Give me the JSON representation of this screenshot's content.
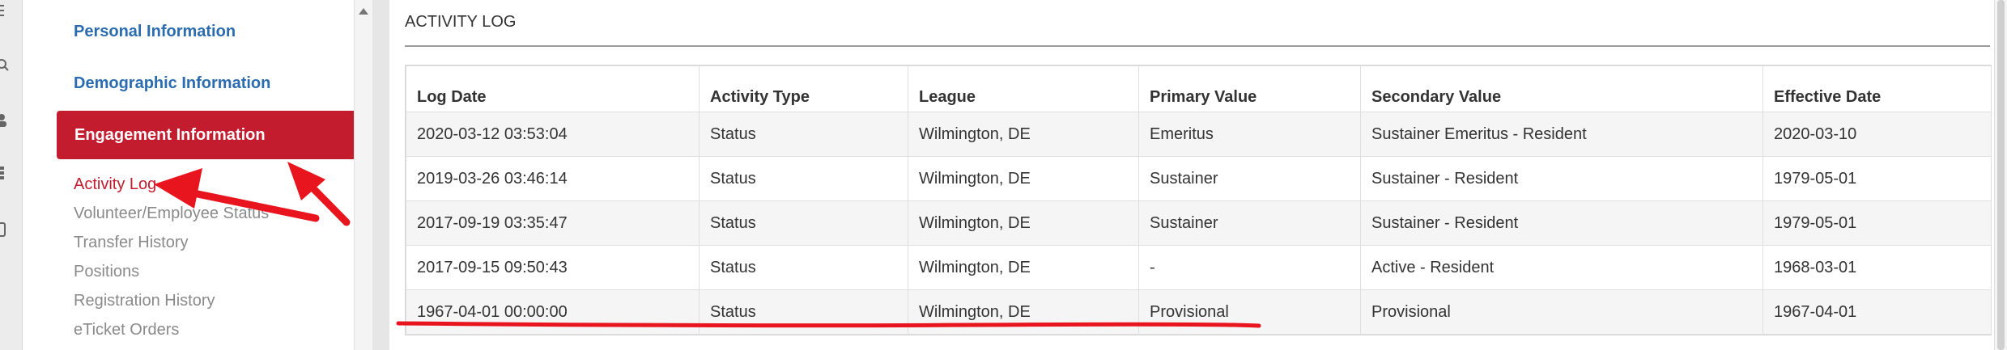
{
  "nav": {
    "items": [
      {
        "label": "Personal Information"
      },
      {
        "label": "Demographic Information"
      },
      {
        "label": "Engagement Information"
      }
    ],
    "subitems": [
      {
        "label": "Activity Log ›"
      },
      {
        "label": "Volunteer/Employee Status"
      },
      {
        "label": "Transfer History"
      },
      {
        "label": "Positions"
      },
      {
        "label": "Registration History"
      },
      {
        "label": "eTicket Orders"
      }
    ]
  },
  "main": {
    "section_title": "ACTIVITY LOG",
    "columns": [
      "Log Date",
      "Activity Type",
      "League",
      "Primary Value",
      "Secondary Value",
      "Effective Date"
    ],
    "rows": [
      [
        "2020-03-12 03:53:04",
        "Status",
        "Wilmington, DE",
        "Emeritus",
        "Sustainer Emeritus - Resident",
        "2020-03-10"
      ],
      [
        "2019-03-26 03:46:14",
        "Status",
        "Wilmington, DE",
        "Sustainer",
        "Sustainer - Resident",
        "1979-05-01"
      ],
      [
        "2017-09-19 03:35:47",
        "Status",
        "Wilmington, DE",
        "Sustainer",
        "Sustainer - Resident",
        "1979-05-01"
      ],
      [
        "2017-09-15 09:50:43",
        "Status",
        "Wilmington, DE",
        "-",
        "Active - Resident",
        "1968-03-01"
      ],
      [
        "1967-04-01 00:00:00",
        "Status",
        "Wilmington, DE",
        "Provisional",
        "Provisional",
        "1967-04-01"
      ]
    ]
  },
  "colors": {
    "accent_red": "#c31c2e",
    "link_blue": "#2b6cb0",
    "annotation_red": "#e8141e"
  },
  "icons": [
    "menu-icon",
    "search-icon",
    "user-icon",
    "grid-icon",
    "device-icon"
  ]
}
